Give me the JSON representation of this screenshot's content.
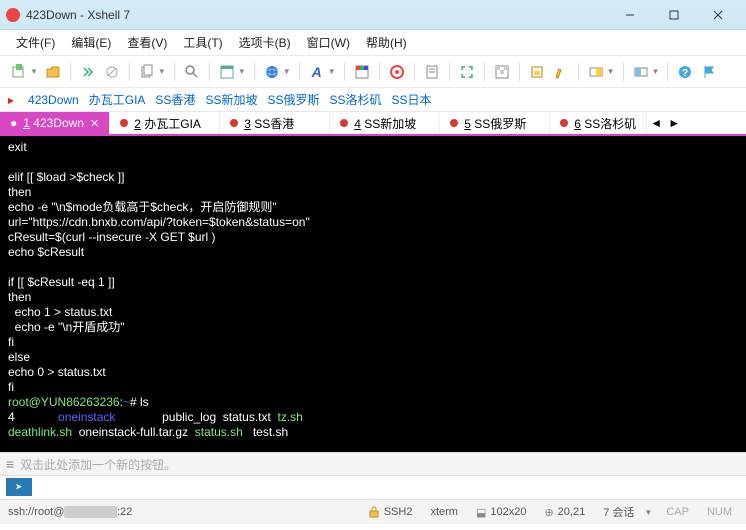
{
  "window": {
    "title": "423Down - Xshell 7"
  },
  "menus": [
    {
      "label": "文件(F)"
    },
    {
      "label": "编辑(E)"
    },
    {
      "label": "查看(V)"
    },
    {
      "label": "工具(T)"
    },
    {
      "label": "选项卡(B)"
    },
    {
      "label": "窗口(W)"
    },
    {
      "label": "帮助(H)"
    }
  ],
  "bookmarks": [
    {
      "label": "423Down"
    },
    {
      "label": "办瓦工GIA"
    },
    {
      "label": "SS香港"
    },
    {
      "label": "SS新加坡"
    },
    {
      "label": "SS俄罗斯"
    },
    {
      "label": "SS洛杉矶"
    },
    {
      "label": "SS日本"
    }
  ],
  "tabs": [
    {
      "n": "1",
      "label": "423Down",
      "active": true
    },
    {
      "n": "2",
      "label": "办瓦工GIA",
      "active": false
    },
    {
      "n": "3",
      "label": "SS香港",
      "active": false
    },
    {
      "n": "4",
      "label": "SS新加坡",
      "active": false
    },
    {
      "n": "5",
      "label": "SS俄罗斯",
      "active": false
    },
    {
      "n": "6",
      "label": "SS洛杉矶",
      "active": false
    }
  ],
  "terminal": {
    "l0": "exit",
    "l1": "",
    "l2": "elif [[ $load >$check ]]",
    "l3": "then",
    "l4": "echo -e \"\\n$mode负载高于$check，开启防御规则\"",
    "l5": "url=\"https://cdn.bnxb.com/api/?token=$token&status=on\"",
    "l6": "cResult=$(curl --insecure -X GET $url )",
    "l7": "echo $cResult",
    "l8": "",
    "l9": "if [[ $cResult -eq 1 ]]",
    "l10": "then",
    "l11": "  echo 1 > status.txt",
    "l12": "  echo -e \"\\n开盾成功\"",
    "l13": "fi",
    "l14": "else",
    "l15": "echo 0 > status.txt",
    "l16": "fi",
    "prompt_user": "root@YUN86263236",
    "prompt_path": "~",
    "prompt_cmd": "ls",
    "ls1_a": "4",
    "ls1_b": "oneinstack",
    "ls1_c": "public_log  status.txt",
    "ls1_d": "tz.sh",
    "ls2_a": "deathlink.sh",
    "ls2_b": "oneinstack-full.tar.gz",
    "ls2_c": "status.sh",
    "ls2_d": "test.sh"
  },
  "compose": {
    "hint": "双击此处添加一个新的按钮。"
  },
  "input": {
    "prompt": "➤"
  },
  "status": {
    "conn": "ssh://root@",
    "conn2": ":22",
    "ssh": "SSH2",
    "term": "xterm",
    "size": "102x20",
    "pos": "20,21",
    "sessions": "7 会话",
    "cap": "CAP",
    "num": "NUM"
  },
  "nav": {
    "left": "◄",
    "right": "►"
  }
}
